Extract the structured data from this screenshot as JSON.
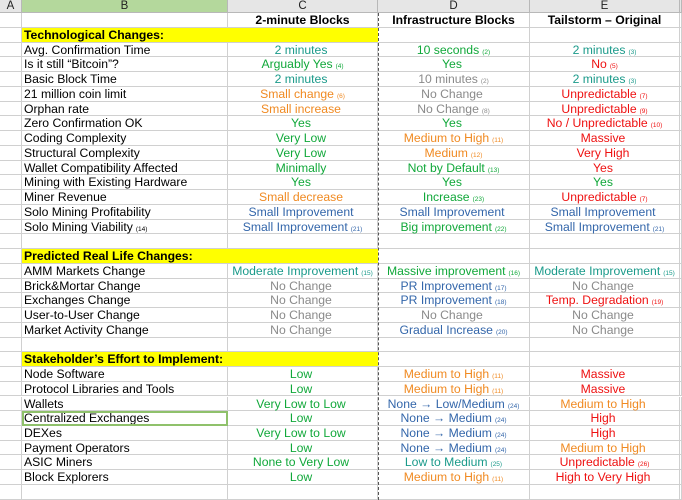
{
  "colors": {
    "teal": "#1a9a8a",
    "green": "#11a83a",
    "gray": "#8a8a8a",
    "orange": "#f08a22",
    "red": "#ee1111",
    "blue": "#3366aa",
    "section_bg": "#ffff00",
    "selected_col_header": "#b4d89c"
  },
  "column_headers": [
    "A",
    "B",
    "C",
    "D",
    "E"
  ],
  "table_headers": {
    "c": "2-minute Blocks",
    "d": "Infrastructure Blocks",
    "e": "Tailstorm – Original"
  },
  "rows": [
    {
      "type": "section",
      "label": "Technological Changes:"
    },
    {
      "type": "data",
      "label": "Avg. Confirmation Time",
      "label_note": "",
      "c": {
        "text": "2 minutes",
        "note": "",
        "color": "teal"
      },
      "d": {
        "text": "10 seconds",
        "note": "(2)",
        "color": "green"
      },
      "e": {
        "text": "2 minutes",
        "note": "(3)",
        "color": "teal"
      }
    },
    {
      "type": "data",
      "label": "Is it still “Bitcoin”?",
      "label_note": "",
      "c": {
        "text": "Arguably Yes",
        "note": "(4)",
        "color": "green"
      },
      "d": {
        "text": "Yes",
        "note": "",
        "color": "green"
      },
      "e": {
        "text": "No",
        "note": "(5)",
        "color": "red"
      }
    },
    {
      "type": "data",
      "label": "Basic Block Time",
      "label_note": "",
      "c": {
        "text": "2 minutes",
        "note": "",
        "color": "teal"
      },
      "d": {
        "text": "10 minutes",
        "note": "(2)",
        "color": "gray"
      },
      "e": {
        "text": "2 minutes",
        "note": "(3)",
        "color": "teal"
      }
    },
    {
      "type": "data",
      "label": "21 million coin limit",
      "label_note": "",
      "c": {
        "text": "Small change",
        "note": "(6)",
        "color": "orange"
      },
      "d": {
        "text": "No Change",
        "note": "",
        "color": "gray"
      },
      "e": {
        "text": "Unpredictable",
        "note": "(7)",
        "color": "red"
      }
    },
    {
      "type": "data",
      "label": "Orphan rate",
      "label_note": "",
      "c": {
        "text": "Small increase",
        "note": "",
        "color": "orange"
      },
      "d": {
        "text": "No Change",
        "note": "(8)",
        "color": "gray"
      },
      "e": {
        "text": "Unpredictable",
        "note": "(9)",
        "color": "red"
      }
    },
    {
      "type": "data",
      "label": "Zero Confirmation OK",
      "label_note": "",
      "c": {
        "text": "Yes",
        "note": "",
        "color": "green"
      },
      "d": {
        "text": "Yes",
        "note": "",
        "color": "green"
      },
      "e": {
        "text": "No / Unpredictable",
        "note": "(10)",
        "color": "red"
      }
    },
    {
      "type": "data",
      "label": "Coding Complexity",
      "label_note": "",
      "c": {
        "text": "Very Low",
        "note": "",
        "color": "green"
      },
      "d": {
        "text": "Medium to High",
        "note": "(11)",
        "color": "orange"
      },
      "e": {
        "text": "Massive",
        "note": "",
        "color": "red"
      }
    },
    {
      "type": "data",
      "label": "Structural Complexity",
      "label_note": "",
      "c": {
        "text": "Very Low",
        "note": "",
        "color": "green"
      },
      "d": {
        "text": "Medium",
        "note": "(12)",
        "color": "orange"
      },
      "e": {
        "text": "Very High",
        "note": "",
        "color": "red"
      }
    },
    {
      "type": "data",
      "label": "Wallet Compatibility Affected",
      "label_note": "",
      "c": {
        "text": "Minimally",
        "note": "",
        "color": "green"
      },
      "d": {
        "text": "Not by Default",
        "note": "(13)",
        "color": "green"
      },
      "e": {
        "text": "Yes",
        "note": "",
        "color": "red"
      }
    },
    {
      "type": "data",
      "label": "Mining with Existing Hardware",
      "label_note": "",
      "c": {
        "text": "Yes",
        "note": "",
        "color": "green"
      },
      "d": {
        "text": "Yes",
        "note": "",
        "color": "green"
      },
      "e": {
        "text": "Yes",
        "note": "",
        "color": "green"
      }
    },
    {
      "type": "data",
      "label": "Miner Revenue",
      "label_note": "",
      "c": {
        "text": "Small decrease",
        "note": "",
        "color": "orange"
      },
      "d": {
        "text": "Increase",
        "note": "(23)",
        "color": "green"
      },
      "e": {
        "text": "Unpredictable",
        "note": "(7)",
        "color": "red"
      }
    },
    {
      "type": "data",
      "label": "Solo Mining Profitability",
      "label_note": "",
      "c": {
        "text": "Small Improvement",
        "note": "",
        "color": "blue"
      },
      "d": {
        "text": "Small Improvement",
        "note": "",
        "color": "blue"
      },
      "e": {
        "text": "Small Improvement",
        "note": "",
        "color": "blue"
      }
    },
    {
      "type": "data",
      "label": "Solo Mining Viability",
      "label_note": "(14)",
      "c": {
        "text": "Small Improvement",
        "note": "(21)",
        "color": "blue"
      },
      "d": {
        "text": "Big improvement",
        "note": "(22)",
        "color": "green"
      },
      "e": {
        "text": "Small Improvement",
        "note": "(21)",
        "color": "blue"
      }
    },
    {
      "type": "empty"
    },
    {
      "type": "section",
      "label": "Predicted Real Life Changes:"
    },
    {
      "type": "data",
      "label": "AMM Markets Change",
      "label_note": "",
      "c": {
        "text": "Moderate Improvement",
        "note": "(15)",
        "color": "teal"
      },
      "d": {
        "text": "Massive improvement",
        "note": "(16)",
        "color": "green"
      },
      "e": {
        "text": "Moderate Improvement",
        "note": "(15)",
        "color": "teal"
      }
    },
    {
      "type": "data",
      "label": "Brick&Mortar Change",
      "label_note": "",
      "c": {
        "text": "No Change",
        "note": "",
        "color": "gray"
      },
      "d": {
        "text": "PR Improvement",
        "note": "(17)",
        "color": "blue"
      },
      "e": {
        "text": "No Change",
        "note": "",
        "color": "gray"
      }
    },
    {
      "type": "data",
      "label": "Exchanges Change",
      "label_note": "",
      "c": {
        "text": "No Change",
        "note": "",
        "color": "gray"
      },
      "d": {
        "text": "PR Improvement",
        "note": "(18)",
        "color": "blue"
      },
      "e": {
        "text": "Temp. Degradation",
        "note": "(19)",
        "color": "red"
      }
    },
    {
      "type": "data",
      "label": "User-to-User Change",
      "label_note": "",
      "c": {
        "text": "No Change",
        "note": "",
        "color": "gray"
      },
      "d": {
        "text": "No Change",
        "note": "",
        "color": "gray"
      },
      "e": {
        "text": "No Change",
        "note": "",
        "color": "gray"
      }
    },
    {
      "type": "data",
      "label": "Market Activity Change",
      "label_note": "",
      "c": {
        "text": "No Change",
        "note": "",
        "color": "gray"
      },
      "d": {
        "text": "Gradual Increase",
        "note": "(20)",
        "color": "blue"
      },
      "e": {
        "text": "No Change",
        "note": "",
        "color": "gray"
      }
    },
    {
      "type": "empty"
    },
    {
      "type": "section",
      "label": "Stakeholder’s Effort to Implement:"
    },
    {
      "type": "data",
      "label": "Node Software",
      "label_note": "",
      "c": {
        "text": "Low",
        "note": "",
        "color": "green"
      },
      "d": {
        "text": "Medium to High",
        "note": "(11)",
        "color": "orange"
      },
      "e": {
        "text": "Massive",
        "note": "",
        "color": "red"
      }
    },
    {
      "type": "data",
      "label": "Protocol Libraries and Tools",
      "label_note": "",
      "c": {
        "text": "Low",
        "note": "",
        "color": "green"
      },
      "d": {
        "text": "Medium to High",
        "note": "(11)",
        "color": "orange"
      },
      "e": {
        "text": "Massive",
        "note": "",
        "color": "red"
      }
    },
    {
      "type": "data",
      "label": "Wallets",
      "label_note": "",
      "c": {
        "text": "Very Low to Low",
        "note": "",
        "color": "green"
      },
      "d": {
        "text": "None → Low/Medium",
        "note": "(24)",
        "color": "blue"
      },
      "e": {
        "text": "Medium to High",
        "note": "",
        "color": "orange"
      }
    },
    {
      "type": "data",
      "label": "Centralized Exchanges",
      "label_note": "",
      "selected": true,
      "c": {
        "text": "Low",
        "note": "",
        "color": "green"
      },
      "d": {
        "text": "None → Medium",
        "note": "(24)",
        "color": "blue"
      },
      "e": {
        "text": "High",
        "note": "",
        "color": "red"
      }
    },
    {
      "type": "data",
      "label": "DEXes",
      "label_note": "",
      "c": {
        "text": "Very Low to Low",
        "note": "",
        "color": "green"
      },
      "d": {
        "text": "None → Medium",
        "note": "(24)",
        "color": "blue"
      },
      "e": {
        "text": "High",
        "note": "",
        "color": "red"
      }
    },
    {
      "type": "data",
      "label": "Payment Operators",
      "label_note": "",
      "c": {
        "text": "Low",
        "note": "",
        "color": "green"
      },
      "d": {
        "text": "None → Medium",
        "note": "(24)",
        "color": "blue"
      },
      "e": {
        "text": "Medium to High",
        "note": "",
        "color": "orange"
      }
    },
    {
      "type": "data",
      "label": "ASIC Miners",
      "label_note": "",
      "c": {
        "text": "None to Very Low",
        "note": "",
        "color": "green"
      },
      "d": {
        "text": "Low to Medium",
        "note": "(25)",
        "color": "teal"
      },
      "e": {
        "text": "Unpredictable",
        "note": "(26)",
        "color": "red"
      }
    },
    {
      "type": "data",
      "label": "Block Explorers",
      "label_note": "",
      "c": {
        "text": "Low",
        "note": "",
        "color": "green"
      },
      "d": {
        "text": "Medium to High",
        "note": "(11)",
        "color": "orange"
      },
      "e": {
        "text": "High to Very High",
        "note": "",
        "color": "red"
      }
    },
    {
      "type": "empty"
    }
  ]
}
